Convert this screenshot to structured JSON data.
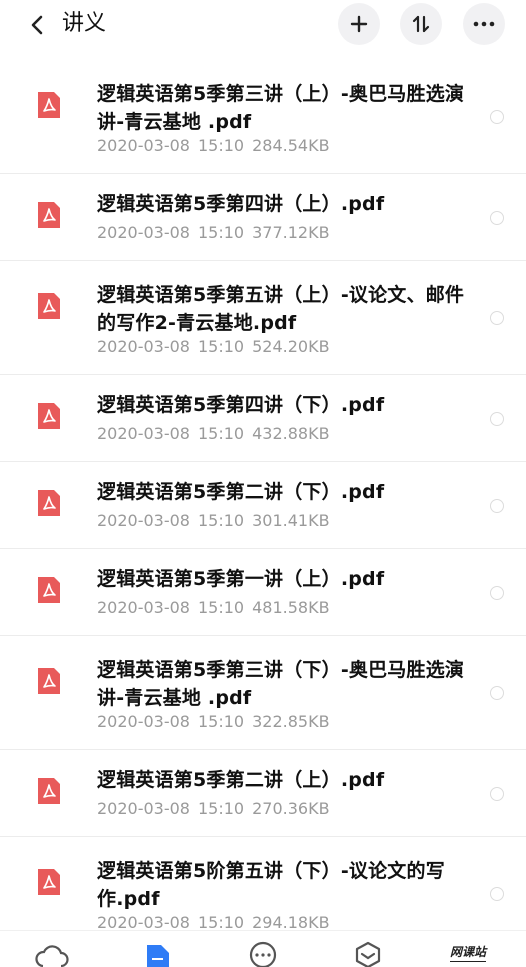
{
  "header": {
    "title": "讲义",
    "back_icon": "chevron-left-icon",
    "add_icon": "plus-icon",
    "sort_icon": "sort-icon",
    "more_icon": "more-horizontal-icon"
  },
  "colors": {
    "pdf_red": "#e85a5a",
    "meta_gray": "#9a9a9a",
    "accent_blue": "#2f7cf6",
    "header_button_bg": "#f1f1f3"
  },
  "files": [
    {
      "name": "逻辑英语第5季第三讲（上）-奥巴马胜选演讲-青云基地 .pdf",
      "date": "2020-03-08",
      "time": "15:10",
      "size": "284.54KB"
    },
    {
      "name": "逻辑英语第5季第四讲（上）.pdf",
      "date": "2020-03-08",
      "time": "15:10",
      "size": "377.12KB"
    },
    {
      "name": "逻辑英语第5季第五讲（上）-议论文、邮件的写作2-青云基地.pdf",
      "date": "2020-03-08",
      "time": "15:10",
      "size": "524.20KB"
    },
    {
      "name": "逻辑英语第5季第四讲（下）.pdf",
      "date": "2020-03-08",
      "time": "15:10",
      "size": "432.88KB"
    },
    {
      "name": "逻辑英语第5季第二讲（下）.pdf",
      "date": "2020-03-08",
      "time": "15:10",
      "size": "301.41KB"
    },
    {
      "name": "逻辑英语第5季第一讲（上）.pdf",
      "date": "2020-03-08",
      "time": "15:10",
      "size": "481.58KB"
    },
    {
      "name": "逻辑英语第5季第三讲（下）-奥巴马胜选演讲-青云基地 .pdf",
      "date": "2020-03-08",
      "time": "15:10",
      "size": "322.85KB"
    },
    {
      "name": "逻辑英语第5季第二讲（上）.pdf",
      "date": "2020-03-08",
      "time": "15:10",
      "size": "270.36KB"
    },
    {
      "name": "逻辑英语第5阶第五讲（下）-议论文的写作.pdf",
      "date": "2020-03-08",
      "time": "15:10",
      "size": "294.18KB"
    }
  ],
  "bottom_nav": {
    "items": [
      {
        "icon": "cloud-icon"
      },
      {
        "icon": "file-icon"
      },
      {
        "icon": "chat-icon"
      },
      {
        "icon": "discover-icon"
      }
    ],
    "watermark": "网课站"
  }
}
